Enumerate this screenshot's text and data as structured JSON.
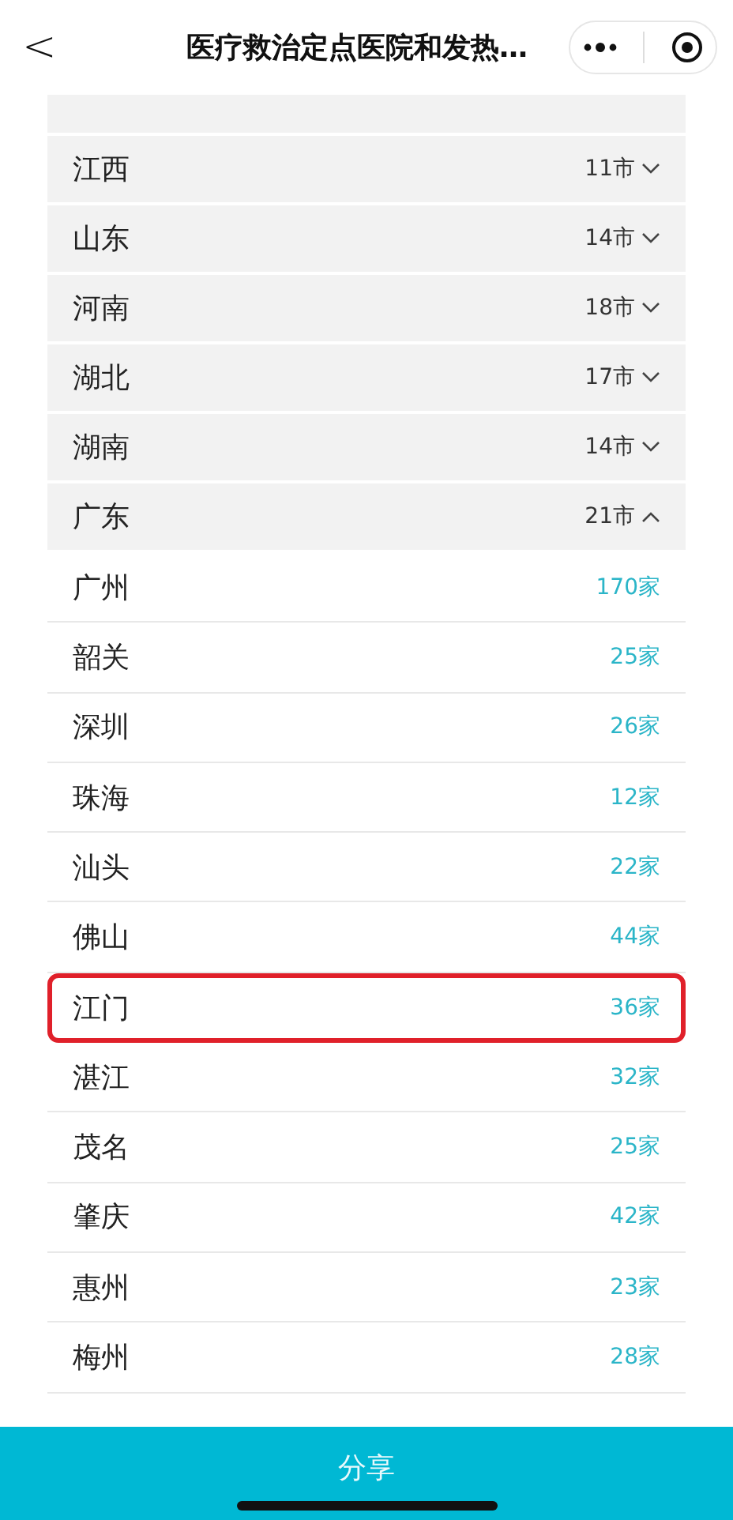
{
  "header": {
    "back": "<",
    "title": "医疗救治定点医院和发热…"
  },
  "provinces": [
    {
      "name": "江西",
      "count": "11市",
      "expanded": false
    },
    {
      "name": "山东",
      "count": "14市",
      "expanded": false
    },
    {
      "name": "河南",
      "count": "18市",
      "expanded": false
    },
    {
      "name": "湖北",
      "count": "17市",
      "expanded": false
    },
    {
      "name": "湖南",
      "count": "14市",
      "expanded": false
    },
    {
      "name": "广东",
      "count": "21市",
      "expanded": true,
      "children": [
        {
          "name": "广州",
          "count": "170家",
          "highlighted": false
        },
        {
          "name": "韶关",
          "count": "25家",
          "highlighted": false
        },
        {
          "name": "深圳",
          "count": "26家",
          "highlighted": false
        },
        {
          "name": "珠海",
          "count": "12家",
          "highlighted": false
        },
        {
          "name": "汕头",
          "count": "22家",
          "highlighted": false
        },
        {
          "name": "佛山",
          "count": "44家",
          "highlighted": false
        },
        {
          "name": "江门",
          "count": "36家",
          "highlighted": true
        },
        {
          "name": "湛江",
          "count": "32家",
          "highlighted": false
        },
        {
          "name": "茂名",
          "count": "25家",
          "highlighted": false
        },
        {
          "name": "肇庆",
          "count": "42家",
          "highlighted": false
        },
        {
          "name": "惠州",
          "count": "23家",
          "highlighted": false
        },
        {
          "name": "梅州",
          "count": "28家",
          "highlighted": false
        }
      ]
    }
  ],
  "footer": {
    "share": "分享"
  }
}
